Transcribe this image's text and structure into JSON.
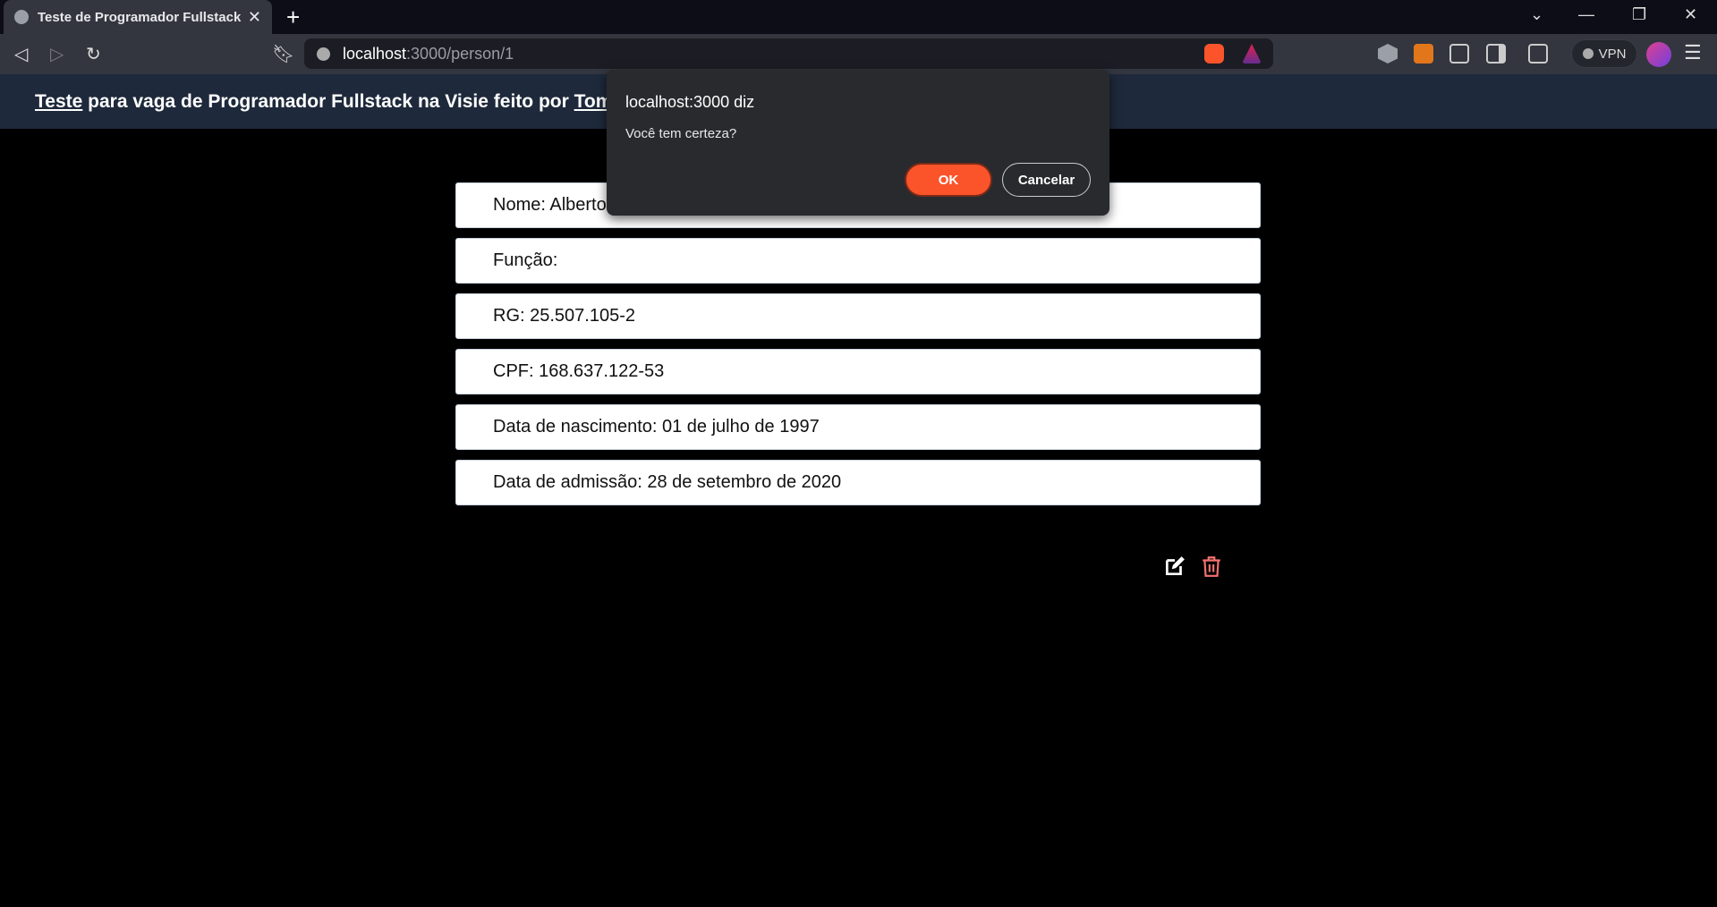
{
  "browser": {
    "tab_title": "Teste de Programador Fullstack",
    "url_host": "localhost",
    "url_path": ":3000/person/1",
    "vpn_label": "VPN"
  },
  "header": {
    "prefix": "Teste",
    "middle": " para vaga de Programador Fullstack na Visie feito por ",
    "author": "Tom"
  },
  "person": {
    "fields": [
      "Nome: Alberto",
      "Função:",
      "RG: 25.507.105-2",
      "CPF: 168.637.122-53",
      "Data de nascimento: 01 de julho de 1997",
      "Data de admissão: 28 de setembro de 2020"
    ]
  },
  "dialog": {
    "title": "localhost:3000 diz",
    "message": "Você tem certeza?",
    "ok": "OK",
    "cancel": "Cancelar"
  },
  "colors": {
    "accent": "#fb542b",
    "delete": "#f87171",
    "header_bg": "#1e293b"
  }
}
